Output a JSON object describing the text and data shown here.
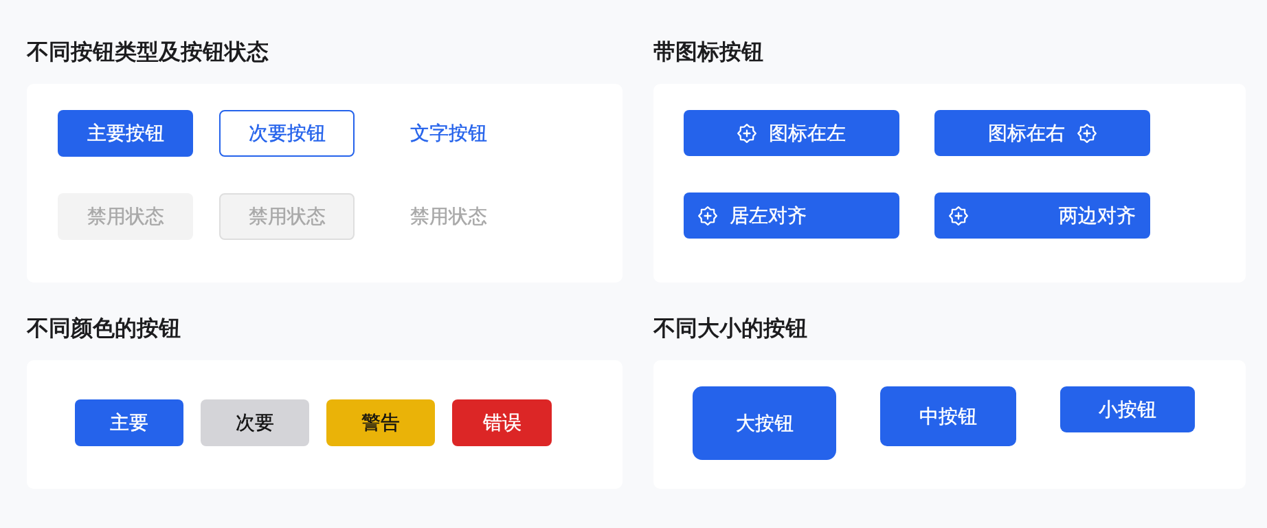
{
  "sections": [
    {
      "kind": "types",
      "title": "不同按钮类型及按钮状态",
      "buttons": [
        {
          "label": "主要按钮",
          "kind": "primary",
          "disabled": false
        },
        {
          "label": "次要按钮",
          "kind": "secondary",
          "disabled": false
        },
        {
          "label": "文字按钮",
          "kind": "text",
          "disabled": false
        },
        {
          "label": "禁用状态",
          "kind": "primary",
          "disabled": true
        },
        {
          "label": "禁用状态",
          "kind": "secondary",
          "disabled": true
        },
        {
          "label": "禁用状态",
          "kind": "text",
          "disabled": true
        }
      ]
    },
    {
      "kind": "icons",
      "title": "带图标按钮",
      "buttons": [
        {
          "label": "图标在左",
          "kind": "leading"
        },
        {
          "label": "图标在右",
          "kind": "trailing"
        },
        {
          "label": "居左对齐",
          "kind": "start"
        },
        {
          "label": "两边对齐",
          "kind": "spread"
        }
      ]
    },
    {
      "kind": "colors",
      "title": "不同颜色的按钮",
      "buttons": [
        {
          "label": "主要",
          "color": "#2563eb"
        },
        {
          "label": "次要",
          "color": "#d4d4d8"
        },
        {
          "label": "警告",
          "color": "#eab308"
        },
        {
          "label": "错误",
          "color": "#dc2626"
        }
      ]
    },
    {
      "kind": "sizes",
      "title": "不同大小的按钮",
      "buttons": [
        {
          "label": "大按钮",
          "kind": "large"
        },
        {
          "label": "中按钮",
          "kind": "medium"
        },
        {
          "label": "小按钮",
          "kind": "small"
        }
      ]
    }
  ]
}
